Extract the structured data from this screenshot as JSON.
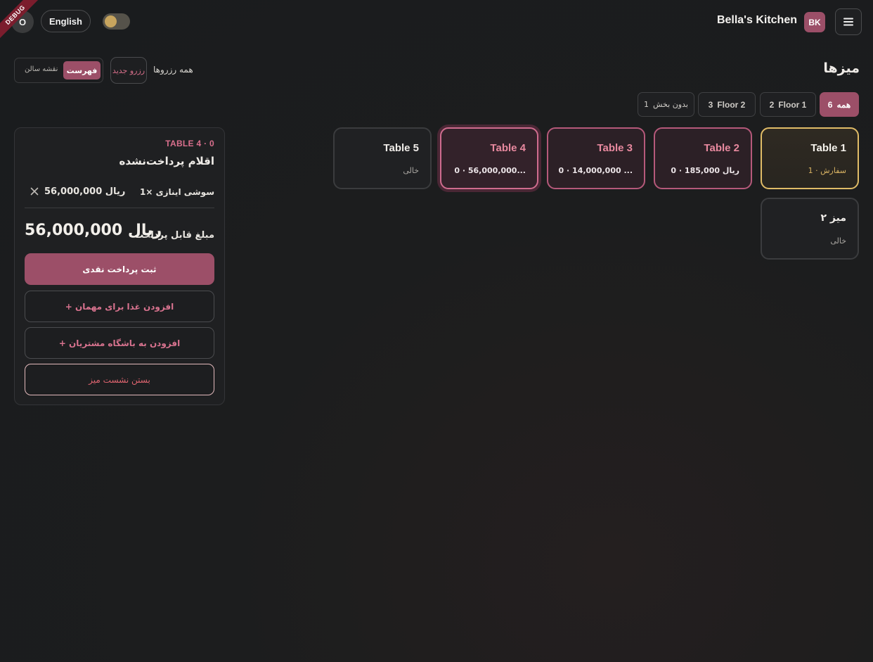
{
  "header": {
    "debug_label": "DEBUG",
    "avatar_initial": "O",
    "language_label": "English",
    "brand_name": "Bella's Kitchen",
    "brand_badge": "BK"
  },
  "toolbar": {
    "page_title": "میزها",
    "all_reservations": "همه رزروها",
    "new_reservation": "رزرو جدید",
    "view_map": "نقشه سالن",
    "view_list": "فهرست"
  },
  "filters": [
    {
      "label": "همه",
      "count": "6",
      "active": true
    },
    {
      "label": "Floor 1",
      "count": "2",
      "active": false
    },
    {
      "label": "Floor 2",
      "count": "3",
      "active": false
    },
    {
      "label": "بدون بخش",
      "count": "1",
      "active": false
    }
  ],
  "tables": [
    {
      "name": "Table 1",
      "sub": "1 · سفارش",
      "state": "occupied"
    },
    {
      "name": "Table 2",
      "sub": "0 · 185,000 ریال",
      "state": "unpaid"
    },
    {
      "name": "Table 3",
      "sub": "0 · 14,000,000 ...",
      "state": "unpaid"
    },
    {
      "name": "Table 4",
      "sub": "0 · 56,000,000...",
      "state": "selected"
    },
    {
      "name": "Table 5",
      "sub": "خالی",
      "state": "empty"
    },
    {
      "name": "میز ۲",
      "sub": "خالی",
      "state": "empty"
    }
  ],
  "panel": {
    "tag": "TABLE 4 · 0",
    "title": "اقلام پرداخت‌نشده",
    "item_name": "1× سوشی اینازی",
    "item_price": "56,000,000 ریال",
    "due_label": "مبلغ قابل پرداخت",
    "due_amount": "56,000,000 ریال",
    "btn_cash": "ثبت پرداخت نقدی",
    "btn_add_food": "+ افزودن غذا برای مهمان",
    "btn_add_club": "+ افزودن به باشگاه مشتریان",
    "btn_close": "بستن نشست میز"
  },
  "colors": {
    "accent": "#9c4f68",
    "accent_text": "#d9738f",
    "occupied": "#e0bc67",
    "background": "#1c1d1f"
  }
}
